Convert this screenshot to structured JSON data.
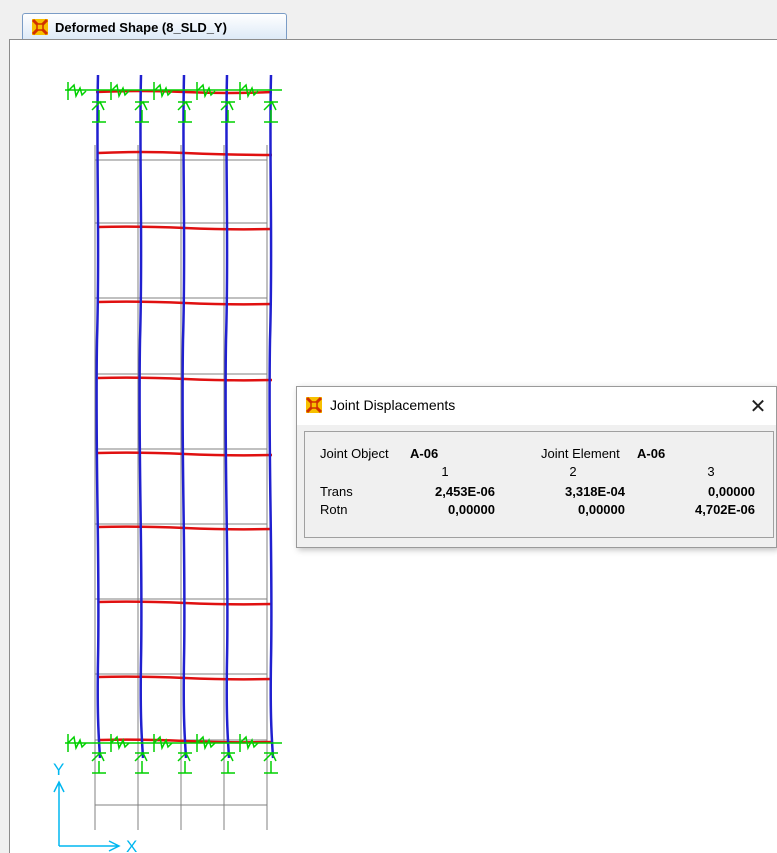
{
  "tab": {
    "title": "Deformed Shape (8_SLD_Y)",
    "icon": "app-logo-icon"
  },
  "axes": {
    "y_label": "Y",
    "x_label": "X",
    "color": "#00b7f0"
  },
  "colors": {
    "frame_deformed": "#2020d0",
    "beam_deformed": "#e01010",
    "undeformed": "#808080",
    "restraint": "#00e000"
  },
  "dialog": {
    "title": "Joint Displacements",
    "close_glyph": "✕",
    "joint_object_label": "Joint Object",
    "joint_object_value": "A-06",
    "joint_element_label": "Joint Element",
    "joint_element_value": "A-06",
    "columns": [
      "1",
      "2",
      "3"
    ],
    "rows": [
      {
        "label": "Trans",
        "values": [
          "2,453E-06",
          "3,318E-04",
          "0,00000"
        ]
      },
      {
        "label": "Rotn",
        "values": [
          "0,00000",
          "0,00000",
          "4,702E-06"
        ]
      }
    ]
  }
}
